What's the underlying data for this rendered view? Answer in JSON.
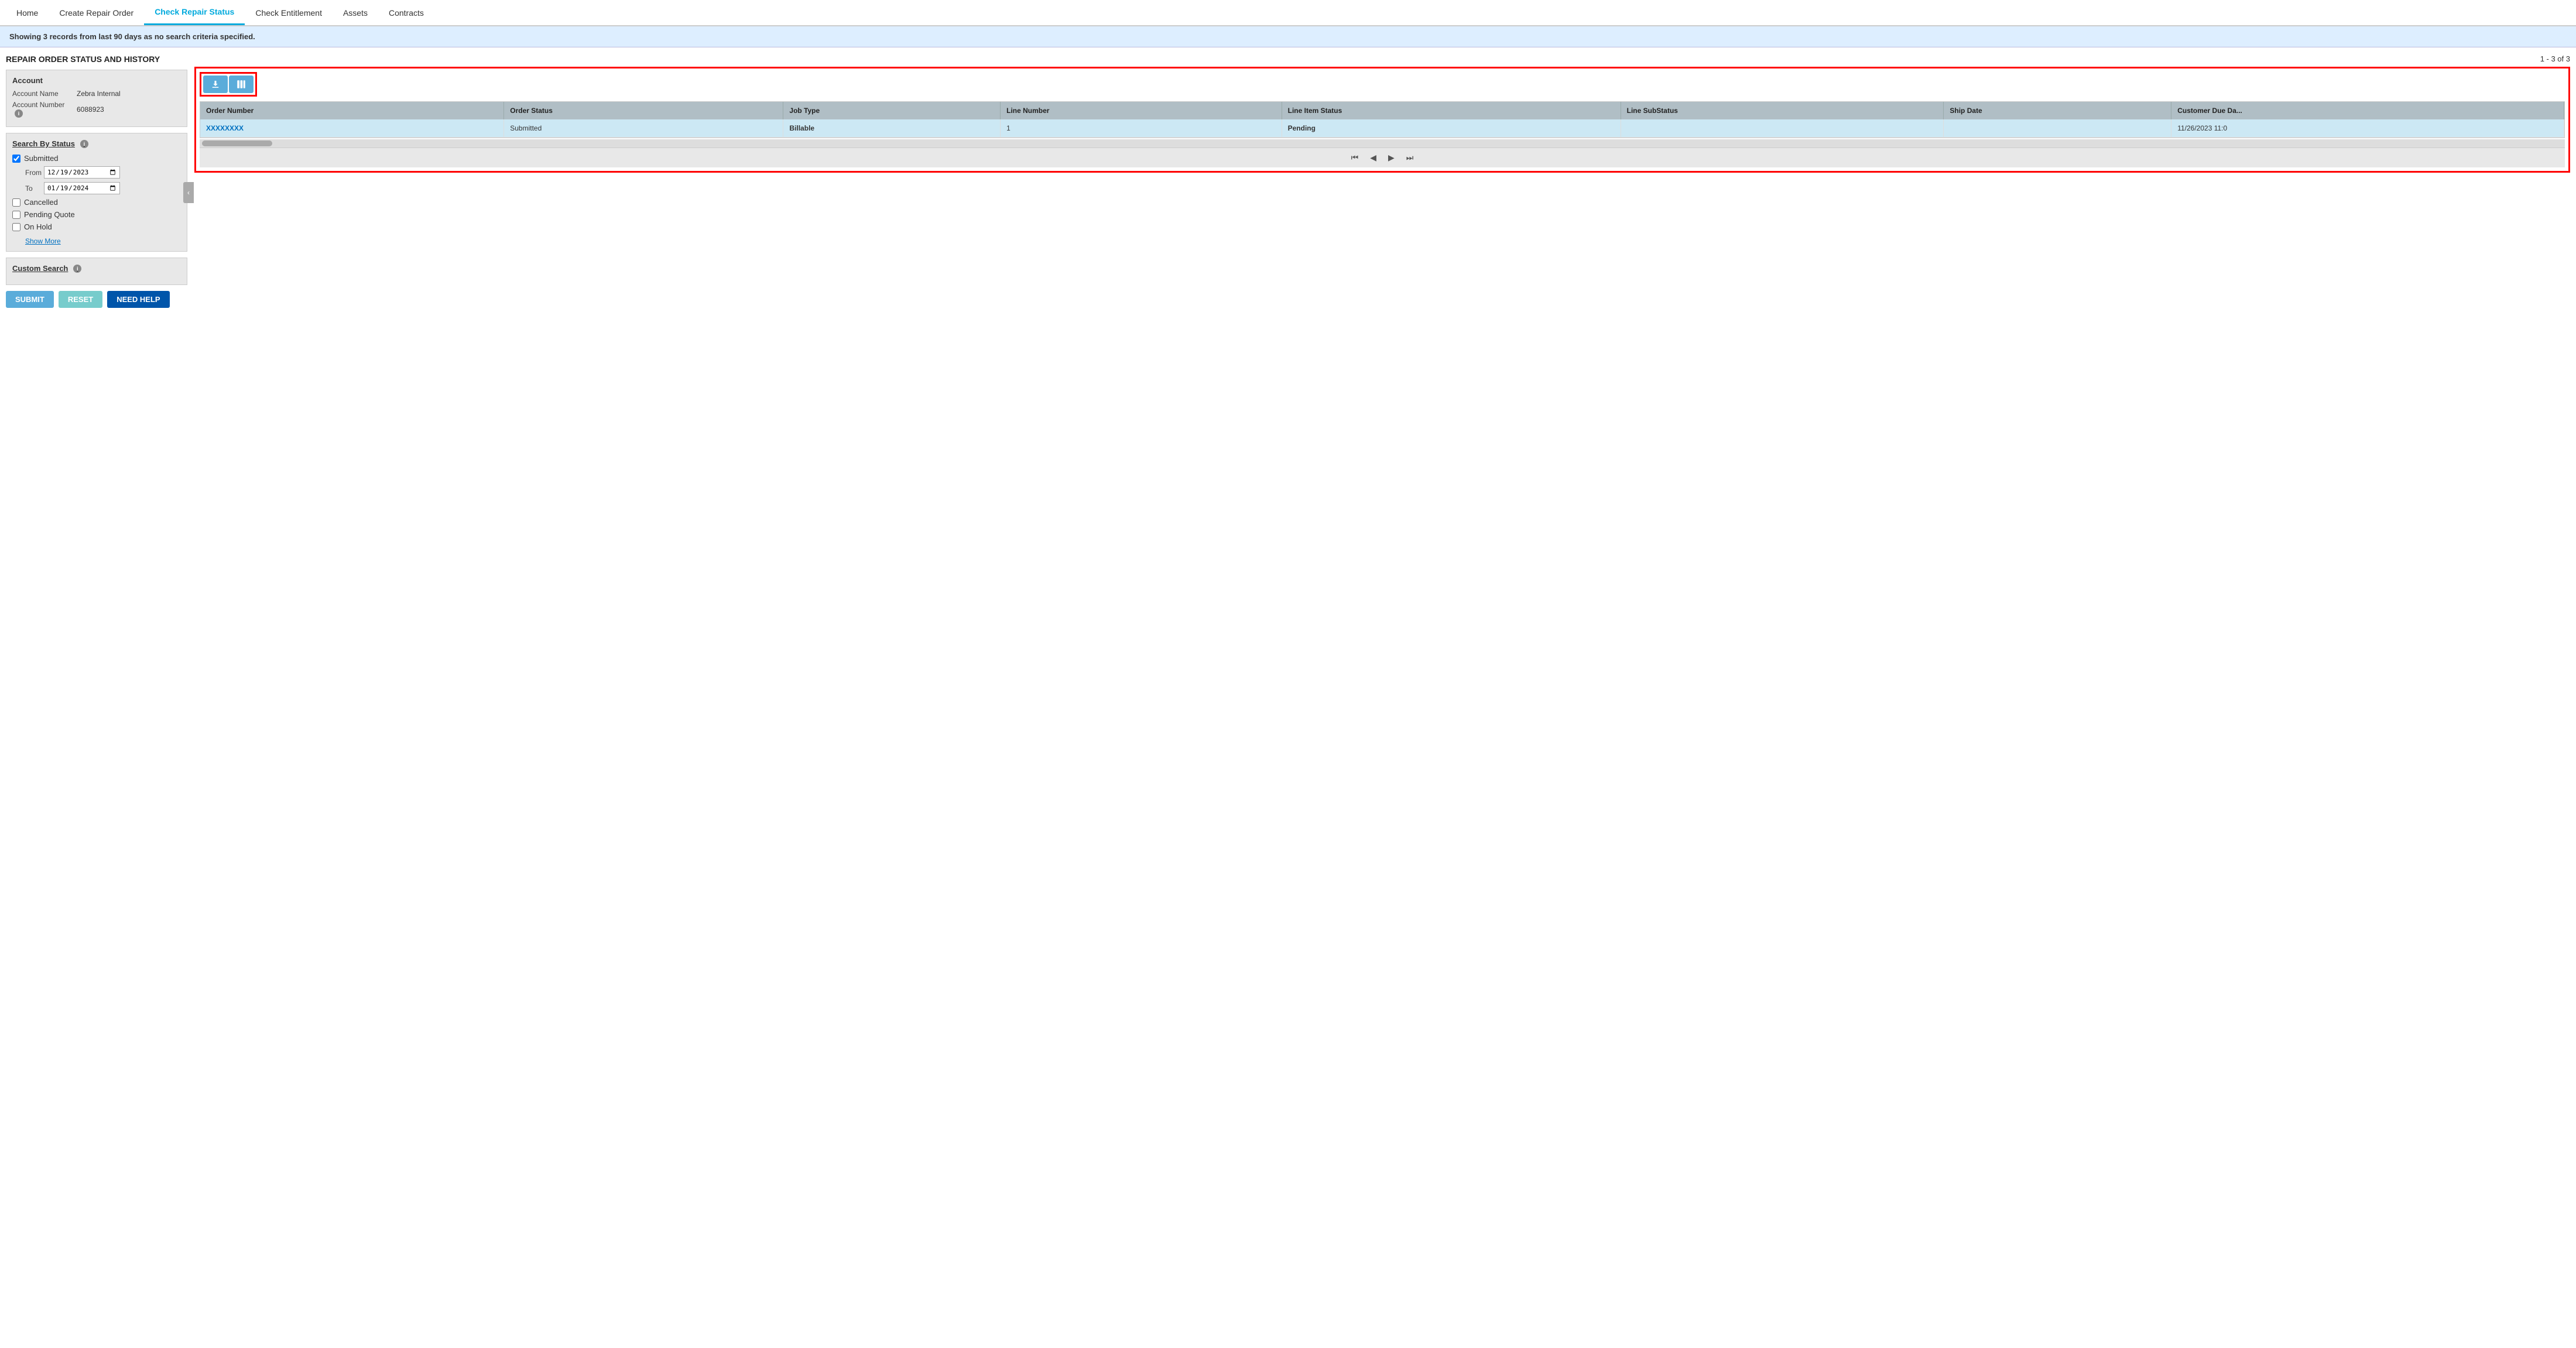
{
  "nav": {
    "items": [
      {
        "label": "Home",
        "active": false
      },
      {
        "label": "Create Repair Order",
        "active": false
      },
      {
        "label": "Check Repair Status",
        "active": true
      },
      {
        "label": "Check Entitlement",
        "active": false
      },
      {
        "label": "Assets",
        "active": false
      },
      {
        "label": "Contracts",
        "active": false
      }
    ]
  },
  "banner": {
    "text": "Showing 3 records from last 90 days as no search criteria specified."
  },
  "leftPanel": {
    "title": "REPAIR ORDER STATUS AND HISTORY",
    "account": {
      "header": "Account",
      "name_label": "Account Name",
      "name_value": "Zebra Internal",
      "number_label": "Account Number",
      "number_value": "6088923"
    },
    "searchByStatus": {
      "label": "Search By Status",
      "checkboxes": [
        {
          "label": "Submitted",
          "checked": true
        },
        {
          "label": "Cancelled",
          "checked": false
        },
        {
          "label": "Pending Quote",
          "checked": false
        },
        {
          "label": "On Hold",
          "checked": false
        }
      ],
      "fromLabel": "From",
      "fromValue": "12/19/2023",
      "toLabel": "To",
      "toValue": "01/19/2024",
      "showMoreLabel": "Show More"
    },
    "customSearch": {
      "label": "Custom Search"
    },
    "buttons": {
      "submit": "SUBMIT",
      "reset": "RESET",
      "needHelp": "NEED HELP"
    }
  },
  "rightPanel": {
    "recordCount": "1 - 3 of 3",
    "table": {
      "columns": [
        "Order Number",
        "Order Status",
        "Job Type",
        "Line Number",
        "Line Item Status",
        "Line SubStatus",
        "Ship Date",
        "Customer Due Da..."
      ],
      "rows": [
        {
          "orderNumber": "XXXXXXXX",
          "orderStatus": "Submitted",
          "jobType": "Billable",
          "lineNumber": "1",
          "lineItemStatus": "Pending",
          "lineSubStatus": "",
          "shipDate": "",
          "customerDueDate": "11/26/2023 11:0",
          "highlight": true
        }
      ]
    },
    "pagination": {
      "first": "⏮",
      "prev": "◀",
      "next": "▶",
      "last": "⏭"
    }
  }
}
